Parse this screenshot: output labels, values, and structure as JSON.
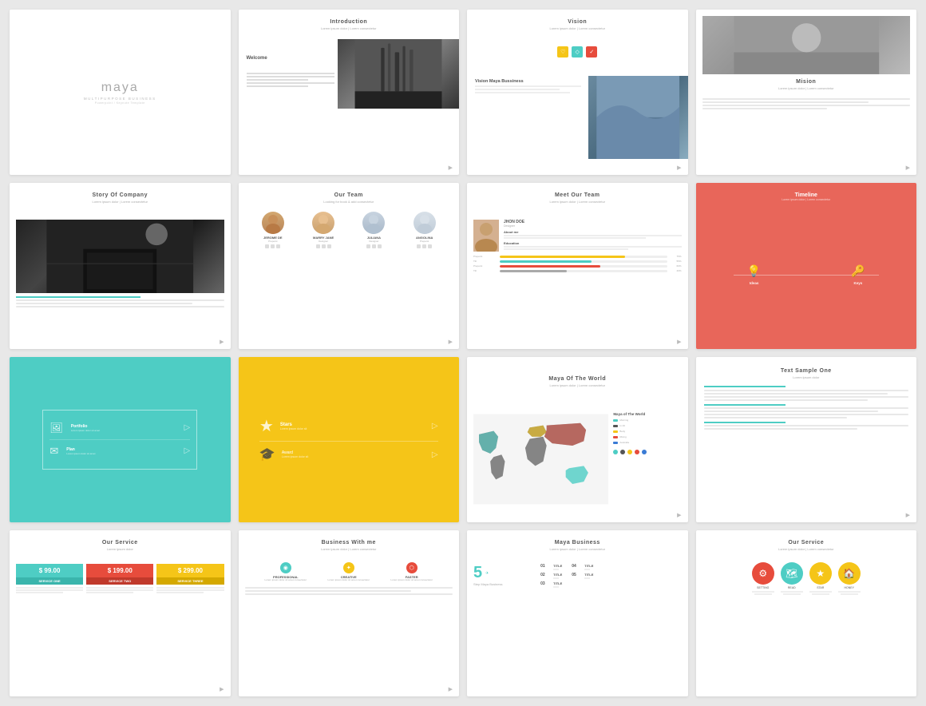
{
  "slides": [
    {
      "id": "maya",
      "title": "maya",
      "subtitle": "MULTIPURPOSE BUSINESS",
      "tagline": "Powerpoint / Keynote Template"
    },
    {
      "id": "introduction",
      "title": "Introduction",
      "subtitle": "Lorem ipsum dolor | Lorem consectetur",
      "welcome": "Welcome",
      "body": "Lorem ipsum dolor sit amet, consectetur adipiscing elit. Nunc quis dui scelerisque, scelerisque urna ut, dapibus orci. Sed eget nibh commodo, bibendum ex vel, fermentum felis."
    },
    {
      "id": "vision",
      "title": "Vision",
      "subtitle": "Lorem ipsum dolor | Lorem consectetur",
      "vision_heading": "Vision Maya Bussiness",
      "icons": [
        "♡",
        "◇",
        "✓"
      ]
    },
    {
      "id": "mission",
      "title": "Mision",
      "subtitle": "Lorem ipsum dolor | Lorem consectetur",
      "body": "Lorem ipsum dolor sit amet, consectetur adipiscing elit, sed do eiusmod tempor incididunt ut labore et dolore magna aliqua."
    },
    {
      "id": "story",
      "title": "Story Of Company",
      "subtitle": "Lorem ipsum dolor | Lorem consectetur",
      "body": "Lorem ipsum dolor sit amet, consectetur adipiscing elit, sed do eiusmod tempor incididunt ut labore et dolore magna aliqua."
    },
    {
      "id": "our-team",
      "title": "Our Team",
      "subtitle": "Looking for book & add consectetur",
      "members": [
        {
          "name": "JEROME DE",
          "role": "Preperst"
        },
        {
          "name": "MARRY JANE",
          "role": "Designer"
        },
        {
          "name": "JULIANA",
          "role": "Designer"
        },
        {
          "name": "ANGOLINA",
          "role": "Preperst"
        }
      ]
    },
    {
      "id": "meet-our-team",
      "title": "Meet Our Team",
      "subtitle": "Lorem ipsum dolor | Lorem consectetur",
      "person_name": "JHON DOE",
      "person_role": "Designer",
      "about_label": "About me",
      "education_label": "Education",
      "skills": [
        {
          "label": "Preperst",
          "pct": 75,
          "color": "#f5c518"
        },
        {
          "label": "Titl",
          "pct": 55,
          "color": "#4ecdc4"
        },
        {
          "label": "Preperst",
          "pct": 60,
          "color": "#e74c3c"
        },
        {
          "label": "Titl",
          "pct": 40,
          "color": "#aaa"
        }
      ]
    },
    {
      "id": "timeline",
      "title": "Timeline",
      "subtitle": "Lorem ipsum dolor | Lorem consectetur",
      "items": [
        {
          "icon": "💡",
          "label": "Ideas"
        },
        {
          "icon": "🔑",
          "label": "Keys"
        }
      ]
    },
    {
      "id": "portfolio",
      "title": "",
      "items": [
        {
          "icon": "🖼",
          "label": "Portfolio",
          "desc": "Lorem ipsum dolor sit amet"
        },
        {
          "icon": "✈",
          "label": "Plan",
          "desc": "Lorem ipsum dolor sit amet"
        }
      ]
    },
    {
      "id": "stars",
      "title": "",
      "items": [
        {
          "icon": "★",
          "label": "Stars",
          "desc": "Lorem ipsum dolor sit"
        },
        {
          "icon": "🎓",
          "label": "Award",
          "desc": "Lorem ipsum dolor sit"
        }
      ]
    },
    {
      "id": "world-map",
      "title": "Maya Of The World",
      "subtitle": "Lorem ipsum dolor | Lorem consectetur",
      "legend": [
        {
          "label": "Morning",
          "color": "#4ecdc4"
        },
        {
          "label": "In 40",
          "color": "#555"
        },
        {
          "label": "Body",
          "color": "#f5c518"
        },
        {
          "label": "Rising",
          "color": "#e74c3c"
        },
        {
          "label": "Australia",
          "color": "#3a7bd5"
        }
      ],
      "side_label": "Maya of The World"
    },
    {
      "id": "text-sample",
      "title": "Text Sample One",
      "subtitle": "Lorem ipsum dolor",
      "body": "Lorem ipsum dolor sit amet, consectetur adipiscing elit, sed do eiusmod tempor incididunt ut labore et dolore magna aliqua. Ut enim ad minim veniam, quis nostrud exercitation ullamco laboris nisi ut aliquip ex ea commodo consequat."
    },
    {
      "id": "our-service-pricing",
      "title": "Our Service",
      "subtitle": "Lorem ipsum dolor",
      "prices": [
        {
          "amount": "$ 99.00",
          "label": "SERVICE ONE",
          "color_top": "#4ecdc4",
          "color_bot": "#3ab5ac"
        },
        {
          "amount": "$ 199.00",
          "label": "SERVICE TWO",
          "color_top": "#e74c3c",
          "color_bot": "#c0392b"
        },
        {
          "amount": "$ 299.00",
          "label": "SERVICE THREE",
          "color_top": "#f5c518",
          "color_bot": "#d4a800"
        }
      ]
    },
    {
      "id": "business-with-me",
      "title": "Business With me",
      "subtitle": "Lorem ipsum dolor | Lorem consectetur",
      "items": [
        {
          "icon": "◉",
          "label": "PROFESSIONAL",
          "color": "#4ecdc4"
        },
        {
          "icon": "✦",
          "label": "CREATIVE",
          "color": "#f5c518"
        },
        {
          "icon": "⬡",
          "label": "FASTER",
          "color": "#e74c3c"
        }
      ]
    },
    {
      "id": "maya-business",
      "title": "Maya Business",
      "subtitle": "Lorem ipsum dolor | Lorem consectetur",
      "big_number": "5",
      "big_label": "Step Maya Business",
      "steps": [
        {
          "num": "01",
          "title": "TITLE",
          "desc": "Lorem ipsum dolor"
        },
        {
          "num": "02",
          "title": "TITLE",
          "desc": "Lorem ipsum dolor"
        },
        {
          "num": "03",
          "title": "TITLE",
          "desc": "Lorem ipsum dolor"
        },
        {
          "num": "04",
          "title": "TITLE",
          "desc": "Lorem ipsum dolor"
        },
        {
          "num": "05",
          "title": "TITLE",
          "desc": "Lorem ipsum dolor"
        }
      ]
    },
    {
      "id": "our-service-circles",
      "title": "Our Service",
      "subtitle": "Lorem ipsum dolor | Lorem consectetur",
      "circles": [
        {
          "icon": "⚙",
          "label": "SETTING",
          "color": "#e74c3c"
        },
        {
          "icon": "★",
          "label": "STAR",
          "color": "#f5c518"
        },
        {
          "icon": "🗺",
          "label": "READ",
          "color": "#4ecdc4"
        },
        {
          "icon": "🏠",
          "label": "HONEY",
          "color": "#f5c518"
        }
      ]
    }
  ],
  "nav_icon": "▶"
}
